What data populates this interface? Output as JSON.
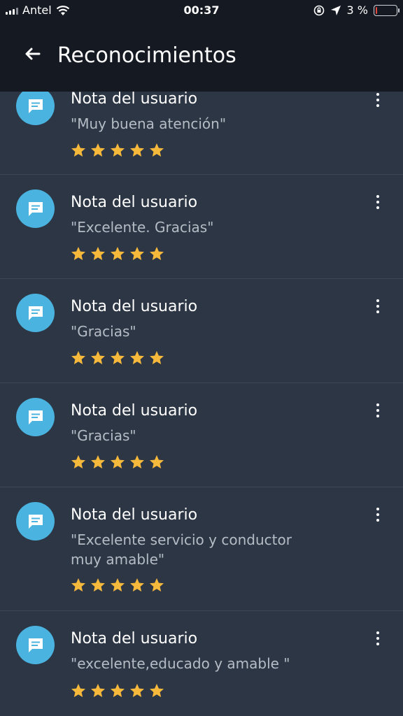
{
  "status_bar": {
    "carrier": "Antel",
    "time": "00:37",
    "battery_text": "3 %",
    "battery_level": 0.03
  },
  "header": {
    "title": "Reconocimientos"
  },
  "colors": {
    "header_bg": "#151a22",
    "list_bg": "#2d3644",
    "avatar": "#4ab3df",
    "star": "#f6b93b"
  },
  "items": [
    {
      "title": "Nota del usuario",
      "note": "\"Muy buena atención\"",
      "rating": 5
    },
    {
      "title": "Nota del usuario",
      "note": "\"Excelente. Gracias\"",
      "rating": 5
    },
    {
      "title": "Nota del usuario",
      "note": "\"Gracias\"",
      "rating": 5
    },
    {
      "title": "Nota del usuario",
      "note": "\"Gracias\"",
      "rating": 5
    },
    {
      "title": "Nota del usuario",
      "note": "\"Excelente servicio y conductor muy amable\"",
      "rating": 5
    },
    {
      "title": "Nota del usuario",
      "note": "\"excelente,educado  y amable \"",
      "rating": 5
    }
  ]
}
